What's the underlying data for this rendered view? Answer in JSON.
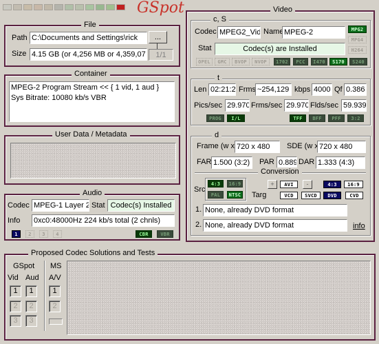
{
  "app": {
    "logo": "GSpot",
    "swatches": [
      "#c8c8c0",
      "#c2bcb0",
      "#c8bca8",
      "#c8b8a8",
      "#c0b8a8",
      "#b4b4ac",
      "#b0c0a8",
      "#b8c0ac",
      "#a8c4a0",
      "#98b890",
      "#a0c090",
      "#c02020"
    ]
  },
  "file": {
    "title": "File",
    "path_label": "Path",
    "path_value": "C:\\Documents and Settings\\rick",
    "browse_label": "...",
    "size_label": "Size",
    "size_value": "4.15 GB (or 4,256 MB or 4,359,07",
    "page_counter": "1/1"
  },
  "container": {
    "title": "Container",
    "line1": "MPEG-2 Program Stream << { 1 vid, 1 aud }",
    "line2": "Sys Bitrate: 10080 kb/s VBR"
  },
  "metadata": {
    "title": "User Data / Metadata"
  },
  "audio": {
    "title": "Audio",
    "codec_label": "Codec",
    "codec_value": "MPEG-1 Layer 2",
    "stat_label": "Stat",
    "stat_value": "Codec(s) Installed",
    "info_label": "Info",
    "info_value": "0xc0:48000Hz  224 kb/s total (2 chnls)",
    "streams": [
      "1",
      "2",
      "3",
      "4"
    ],
    "flags": [
      "CBR",
      "VBR"
    ]
  },
  "video": {
    "title": "Video",
    "cs_title": "c, S",
    "codec_label": "Codec",
    "codec_value": "MPEG2_Vid",
    "name_label": "Name",
    "name_value": "MPEG-2",
    "stat_label": "Stat",
    "stat_value": "Codec(s) are Installed",
    "side_flags": [
      "MPG2",
      "MPG4",
      "H264"
    ],
    "codec_flags": [
      "OPEL",
      "GMC",
      "BVOP",
      "NVOP",
      "1702",
      "PCC",
      "I470",
      "S170",
      "S240"
    ],
    "t_title": "t",
    "len_label": "Len",
    "len_value": "02:21:2",
    "frms_label": "Frms",
    "frms_value": "~254,129",
    "kbps_label": "kbps",
    "kbps_value": "4000",
    "qf_label": "Qf",
    "qf_value": "0.386",
    "pics_label": "Pics/sec",
    "pics_value": "29.970",
    "frms_sec_label": "Frms/sec",
    "frms_sec_value": "29.970",
    "flds_label": "Flds/sec",
    "flds_value": "59.939",
    "t_flags_left": [
      "PROG",
      "I/L"
    ],
    "t_flags_right": [
      "TFF",
      "BFF",
      "PFF",
      "3:2"
    ],
    "d_title": "d",
    "frame_label": "Frame (w x",
    "frame_value": "720 x 480",
    "sde_label": "SDE (w x",
    "sde_value": "720 x 480",
    "far_label": "FAR",
    "far_value": "1.500 (3:2)",
    "par_label": "PAR",
    "par_value": "0.889",
    "dar_label": "DAR",
    "dar_value": "1.333 (4:3)",
    "conversion_title": "Conversion",
    "src_label": "Src",
    "src_flags": [
      "4:3",
      "16:9",
      "PAL",
      "NTSC"
    ],
    "targ_label": "Targ",
    "targ_top": [
      "+",
      "AVI",
      "-",
      "4:3",
      "16:9"
    ],
    "targ_bottom": [
      "VCD",
      "SVCD",
      "DVD",
      "CVD"
    ],
    "conv1_prefix": "1.",
    "conv1_value": "None, already DVD format",
    "conv2_prefix": "2.",
    "conv2_value": "None, already DVD format",
    "info_link": "info"
  },
  "proposed": {
    "title": "Proposed Codec Solutions and Tests",
    "gspot_label": "GSpot",
    "ms_label": "MS",
    "vid_label": "Vid",
    "aud_label": "Aud",
    "av_label": "A/V",
    "vid_buttons": [
      "1",
      "2",
      "3"
    ],
    "aud_buttons": [
      "1",
      "2",
      "3"
    ],
    "av_buttons": [
      "1",
      "2"
    ]
  }
}
